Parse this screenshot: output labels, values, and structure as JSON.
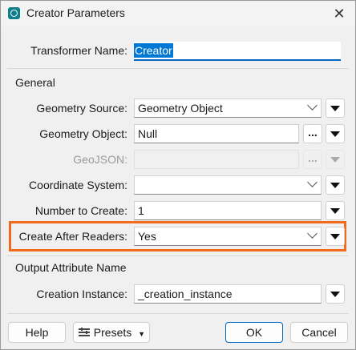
{
  "window": {
    "title": "Creator Parameters",
    "close_glyph": "✕"
  },
  "transformer": {
    "label": "Transformer Name:",
    "value": "Creator"
  },
  "general": {
    "heading": "General",
    "geometry_source": {
      "label": "Geometry Source:",
      "value": "Geometry Object"
    },
    "geometry_object": {
      "label": "Geometry Object:",
      "value": "Null",
      "button": "..."
    },
    "geojson": {
      "label": "GeoJSON:",
      "value": "",
      "button": "..."
    },
    "coordinate_system": {
      "label": "Coordinate System:",
      "value": ""
    },
    "number_to_create": {
      "label": "Number to Create:",
      "value": "1"
    },
    "create_after_readers": {
      "label": "Create After Readers:",
      "value": "Yes"
    }
  },
  "output": {
    "heading": "Output Attribute Name",
    "creation_instance": {
      "label": "Creation Instance:",
      "value": "_creation_instance"
    }
  },
  "footer": {
    "help": "Help",
    "presets": "Presets",
    "ok": "OK",
    "cancel": "Cancel"
  },
  "colors": {
    "accent": "#0067c0",
    "highlight": "#f26b1d"
  }
}
